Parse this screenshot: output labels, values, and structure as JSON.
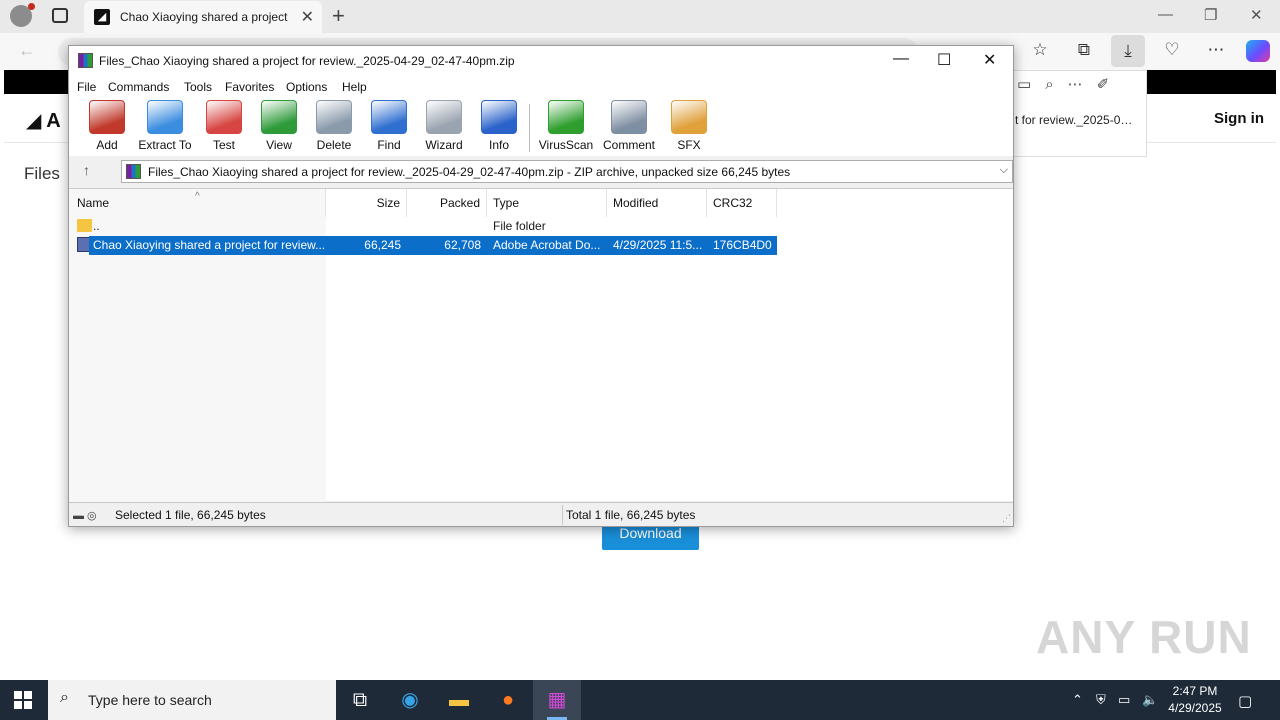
{
  "browser": {
    "tab_title": "Chao Xiaoying shared a project f…",
    "icons": {
      "back": "back-arrow-icon",
      "favorites": "star-plus-icon",
      "collections": "collections-icon",
      "downloads": "download-icon",
      "performance": "heart-pulse-icon",
      "more": "ellipsis-icon",
      "copilot": "copilot-icon"
    }
  },
  "webpage": {
    "logo": "A",
    "sign_in": "Sign in",
    "files_label": "Files",
    "download_button": "Download",
    "download_popup_text": "t for review._2025-0…",
    "watermark": "ANY RUN"
  },
  "winrar": {
    "title": "Files_Chao Xiaoying shared a project for review._2025-04-29_02-47-40pm.zip",
    "menu": [
      "File",
      "Commands",
      "Tools",
      "Favorites",
      "Options",
      "Help"
    ],
    "toolbar": [
      {
        "label": "Add",
        "icon": "add-archive-icon",
        "color": "#c0392b"
      },
      {
        "label": "Extract To",
        "icon": "extract-folder-icon",
        "color": "#3b8de0"
      },
      {
        "label": "Test",
        "icon": "test-clipboard-icon",
        "color": "#d64541"
      },
      {
        "label": "View",
        "icon": "view-book-icon",
        "color": "#2e9b3b"
      },
      {
        "label": "Delete",
        "icon": "trash-can-icon",
        "color": "#8a9aab"
      },
      {
        "label": "Find",
        "icon": "magnifier-icon",
        "color": "#2f6fd0"
      },
      {
        "label": "Wizard",
        "icon": "magic-wand-icon",
        "color": "#9aa4b0"
      },
      {
        "label": "Info",
        "icon": "info-icon",
        "color": "#2a62c9"
      },
      {
        "label": "VirusScan",
        "icon": "virus-scan-icon",
        "color": "#2e9e2e"
      },
      {
        "label": "Comment",
        "icon": "comment-icon",
        "color": "#7f8fa3"
      },
      {
        "label": "SFX",
        "icon": "sfx-box-icon",
        "color": "#e0a03a"
      }
    ],
    "path": "Files_Chao Xiaoying shared a project for review._2025-04-29_02-47-40pm.zip - ZIP archive, unpacked size 66,245 bytes",
    "columns": [
      "Name",
      "Size",
      "Packed",
      "Type",
      "Modified",
      "CRC32"
    ],
    "rows": [
      {
        "name": "..",
        "size": "",
        "packed": "",
        "type": "File folder",
        "modified": "",
        "crc": "",
        "selected": false
      },
      {
        "name": "Chao Xiaoying shared a project for review....",
        "size": "66,245",
        "packed": "62,708",
        "type": "Adobe Acrobat Do...",
        "modified": "4/29/2025 11:5...",
        "crc": "176CB4D0",
        "selected": true
      }
    ],
    "status_left": "Selected 1 file, 66,245 bytes",
    "status_right": "Total 1 file, 66,245 bytes"
  },
  "taskbar": {
    "search_placeholder": "Type here to search",
    "time": "2:47 PM",
    "date": "4/29/2025"
  }
}
